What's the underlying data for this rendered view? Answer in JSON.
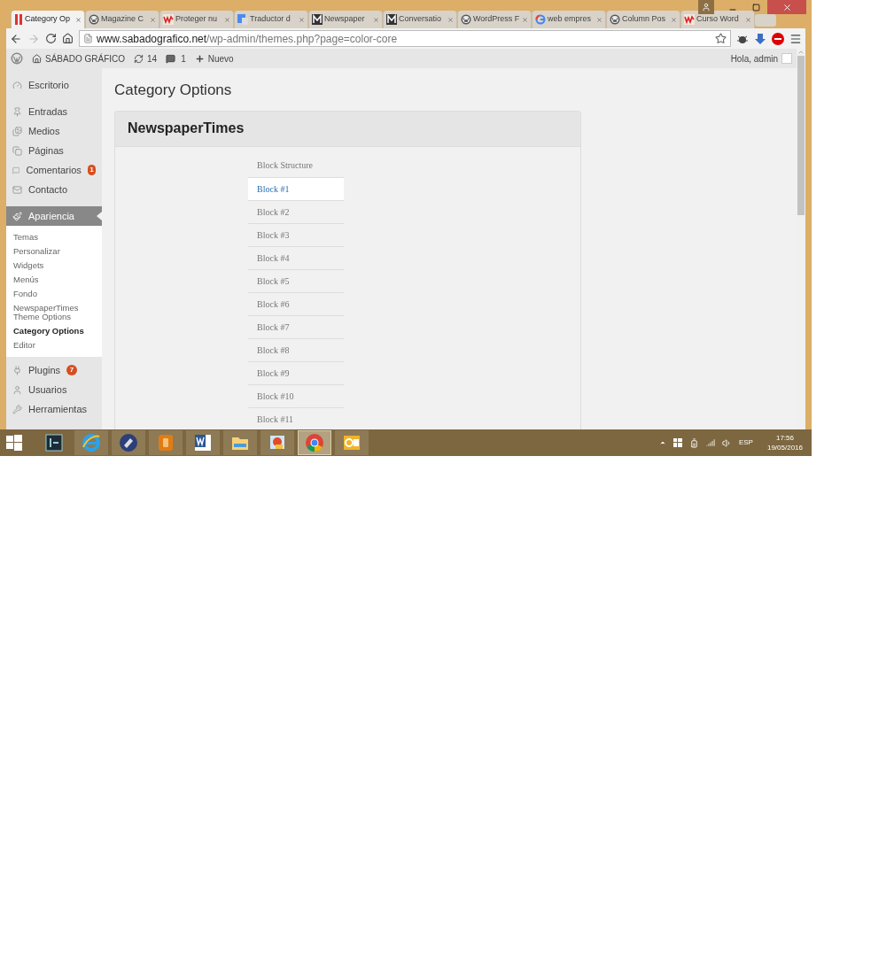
{
  "browser_tabs": [
    {
      "label": "Category Op",
      "selected": true
    },
    {
      "label": "Magazine C",
      "selected": false
    },
    {
      "label": "Proteger nu",
      "selected": false
    },
    {
      "label": "Traductor d",
      "selected": false
    },
    {
      "label": "Newspaper",
      "selected": false
    },
    {
      "label": "Conversatio",
      "selected": false
    },
    {
      "label": "WordPress F",
      "selected": false
    },
    {
      "label": "web empres",
      "selected": false
    },
    {
      "label": "Column Pos",
      "selected": false
    },
    {
      "label": "Curso Word",
      "selected": false
    }
  ],
  "address_bar": {
    "domain": "www.sabadografico.net",
    "path": "/wp-admin/themes.php?page=color-core"
  },
  "admin_bar": {
    "site": "SÁBADO GRÁFICO",
    "updates": "14",
    "comments": "1",
    "new": "Nuevo",
    "greeting": "Hola, admin"
  },
  "sidebar": {
    "items": [
      {
        "label": "Escritorio",
        "selected": false
      },
      {
        "label": "Entradas",
        "selected": false
      },
      {
        "label": "Medios",
        "selected": false
      },
      {
        "label": "Páginas",
        "selected": false
      },
      {
        "label": "Comentarios",
        "badge": "1",
        "selected": false
      },
      {
        "label": "Contacto",
        "selected": false
      },
      {
        "label": "Apariencia",
        "selected": true,
        "children": [
          {
            "label": "Temas",
            "selected": false
          },
          {
            "label": "Personalizar",
            "selected": false
          },
          {
            "label": "Widgets",
            "selected": false
          },
          {
            "label": "Menús",
            "selected": false
          },
          {
            "label": "Fondo",
            "selected": false
          },
          {
            "label": "NewspaperTimes Theme Options",
            "selected": false
          },
          {
            "label": "Category Options",
            "selected": true
          },
          {
            "label": "Editor",
            "selected": false
          }
        ]
      },
      {
        "label": "Plugins",
        "badge": "7",
        "selected": false
      },
      {
        "label": "Usuarios",
        "selected": false
      },
      {
        "label": "Herramientas",
        "selected": false
      }
    ]
  },
  "page_title": "Category Options",
  "panel": {
    "title": "NewspaperTimes",
    "list_heading": "Block Structure",
    "blocks": [
      {
        "label": "Block #1",
        "selected": true
      },
      {
        "label": "Block #2",
        "selected": false
      },
      {
        "label": "Block #3",
        "selected": false
      },
      {
        "label": "Block #4",
        "selected": false
      },
      {
        "label": "Block #5",
        "selected": false
      },
      {
        "label": "Block #6",
        "selected": false
      },
      {
        "label": "Block #7",
        "selected": false
      },
      {
        "label": "Block #8",
        "selected": false
      },
      {
        "label": "Block #9",
        "selected": false
      },
      {
        "label": "Block #10",
        "selected": false
      },
      {
        "label": "Block #11",
        "selected": false
      }
    ]
  },
  "taskbar": {
    "apps": [
      {
        "selected": false
      },
      {
        "selected": false
      },
      {
        "selected": false
      },
      {
        "selected": false
      },
      {
        "selected": false
      },
      {
        "selected": false
      },
      {
        "selected": false
      },
      {
        "selected": true
      },
      {
        "selected": false
      }
    ],
    "language": "ESP",
    "time": "17:56",
    "date": "19/05/2016"
  }
}
